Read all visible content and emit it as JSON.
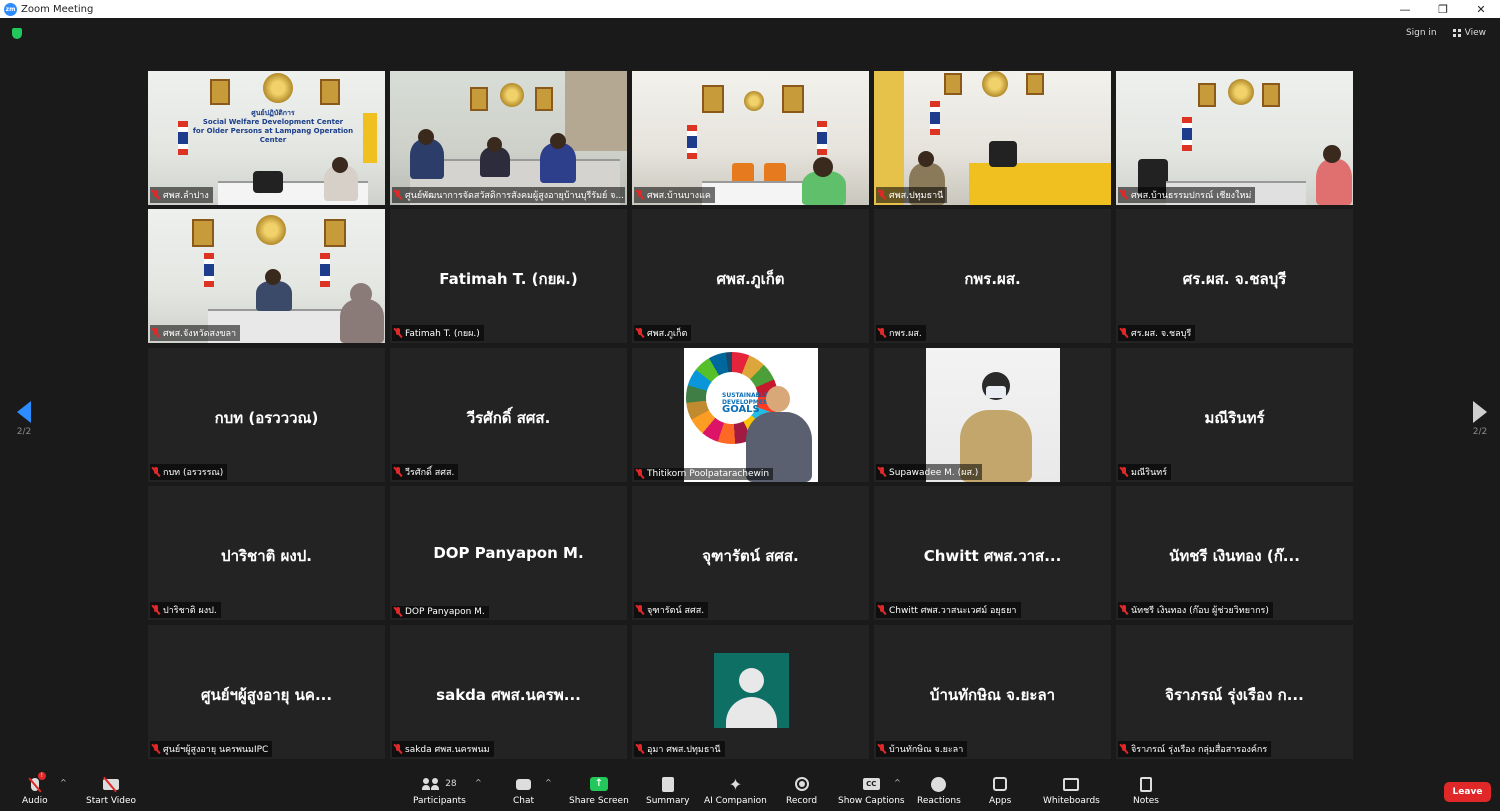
{
  "window": {
    "title": "Zoom Meeting",
    "logo_text": "zm"
  },
  "topbar": {
    "sign_in": "Sign in",
    "view": "View"
  },
  "pagination": {
    "left": "2/2",
    "right": "2/2"
  },
  "tiles": [
    {
      "kind": "video",
      "scene": "lampang",
      "label": "ศพส.ลำปาง"
    },
    {
      "kind": "video",
      "scene": "meeting",
      "label": "ศูนย์พัฒนาการจัดสวัสดิการสังคมผู้สูงอายุบ้านบุรีรัมย์ จ..."
    },
    {
      "kind": "video",
      "scene": "bangkhae",
      "label": "ศพส.บ้านบางแค"
    },
    {
      "kind": "video",
      "scene": "pathum",
      "label": "ศพส.ปทุมธานี"
    },
    {
      "kind": "video",
      "scene": "chiangmai",
      "label": "ศพส.บ้านธรรมปกรณ์ เชียงใหม่"
    },
    {
      "kind": "video",
      "scene": "songkhla",
      "label": "ศพส.จังหวัดสงขลา"
    },
    {
      "kind": "name",
      "name": "Fatimah T. (กยผ.)",
      "label": "Fatimah T. (กยผ.)"
    },
    {
      "kind": "name",
      "name": "ศพส.ภูเก็ต",
      "label": "ศพส.ภูเก็ต"
    },
    {
      "kind": "name",
      "name": "กพร.ผส.",
      "label": "กพร.ผส."
    },
    {
      "kind": "name",
      "name": "ศร.ผส. จ.ชลบุรี",
      "label": "ศร.ผส. จ.ชลบุรี"
    },
    {
      "kind": "name",
      "name": "กบท (อรวววณ)",
      "label": "กบท (อรวรรณ)"
    },
    {
      "kind": "name",
      "name": "วีรศักดิ์ สศส.",
      "label": "วีรศักดิ์ สศส."
    },
    {
      "kind": "video",
      "scene": "sdg",
      "label": "Thitikorn Poolpatarachewin"
    },
    {
      "kind": "video",
      "scene": "officer",
      "label": "Supawadee M. (ผส.)"
    },
    {
      "kind": "name",
      "name": "มณีรินทร์",
      "label": "มณีรินทร์"
    },
    {
      "kind": "name",
      "name": "ปาริชาติ ผงป.",
      "label": "ปาริชาติ ผงป."
    },
    {
      "kind": "name",
      "name": "DOP Panyapon M.",
      "label": "DOP Panyapon M."
    },
    {
      "kind": "name",
      "name": "จุฑารัตน์ สศส.",
      "label": "จุฑารัตน์ สศส."
    },
    {
      "kind": "name",
      "name": "Chwitt ศพส.วาส...",
      "label": "Chwitt ศพส.วาสนะเวศม์ อยุธยา"
    },
    {
      "kind": "name",
      "name": "นัทชรี เงินทอง (ก๊...",
      "label": "นัทชรี เงินทอง (ก๊อบ ผู้ช่วยวิทยากร)"
    },
    {
      "kind": "name",
      "name": "ศูนย์ฯผู้สูงอายุ นค...",
      "label": "ศูนย์ฯผู้สูงอายุ นครพนมIPC"
    },
    {
      "kind": "name",
      "name": "sakda ศพส.นครพ...",
      "label": "sakda ศพส.นครพนม"
    },
    {
      "kind": "avatar",
      "label": "อุมา ศพส.ปทุมธานี"
    },
    {
      "kind": "name",
      "name": "บ้านทักษิณ จ.ยะลา",
      "label": "บ้านทักษิณ จ.ยะลา"
    },
    {
      "kind": "name",
      "name": "จิราภรณ์ รุ่งเรือง ก...",
      "label": "จิราภรณ์ รุ่งเรือง กลุ่มสื่อสารองค์กร"
    }
  ],
  "scenes": {
    "lampang_sign": "ศูนย์ปฏิบัติการ",
    "lampang_sign_en1": "Social Welfare Development Center",
    "lampang_sign_en2": "for Older Persons at Lampang Operation Center",
    "sdg_line1": "SUSTAINABLE",
    "sdg_line2": "DEVELOPMENT",
    "sdg_goals": "GOALS"
  },
  "toolbar": {
    "audio": "Audio",
    "audio_badge": "!",
    "start_video": "Start Video",
    "participants": "Participants",
    "participants_count": "28",
    "chat": "Chat",
    "share_screen": "Share Screen",
    "summary": "Summary",
    "ai_companion": "AI Companion",
    "record": "Record",
    "show_captions": "Show Captions",
    "captions_icon": "CC",
    "reactions": "Reactions",
    "apps": "Apps",
    "whiteboards": "Whiteboards",
    "notes": "Notes",
    "leave": "Leave"
  },
  "colors": {
    "accent": "#2d8cff",
    "share": "#23c85b",
    "leave": "#e02828",
    "avatar_bg": "#0e6f65"
  }
}
